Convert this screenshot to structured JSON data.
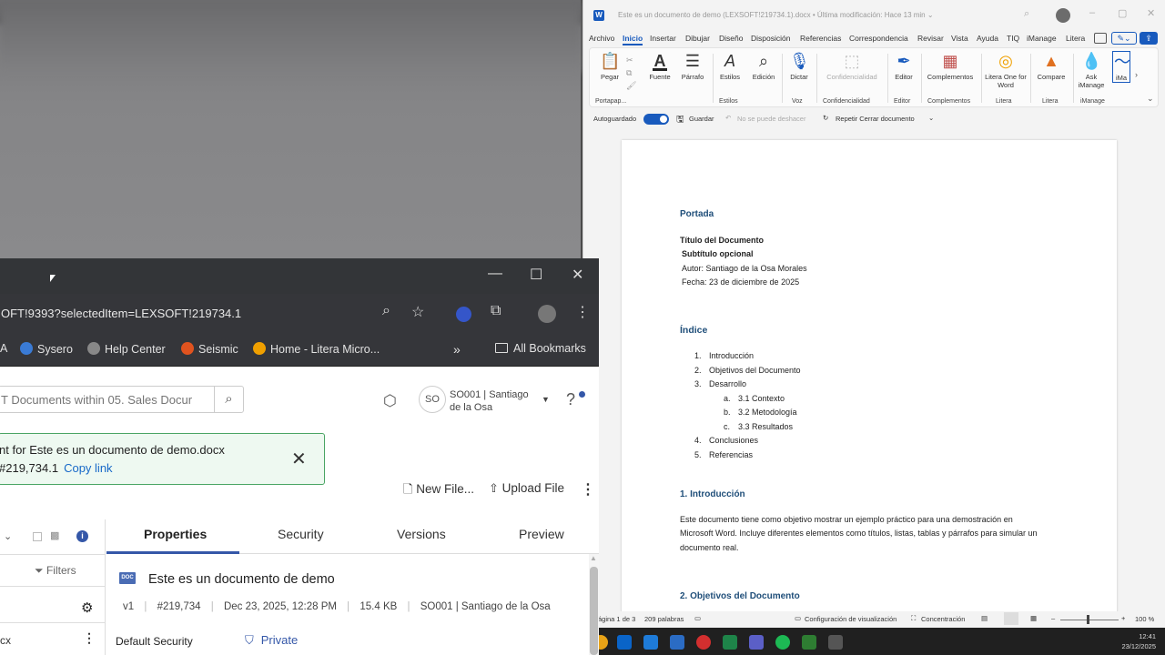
{
  "word": {
    "title": "Este es un documento de demo (LEXSOFT!219734.1).docx • Última modificación: Hace 13 min ⌄",
    "menu": [
      "Archivo",
      "Inicio",
      "Insertar",
      "Dibujar",
      "Diseño",
      "Disposición",
      "Referencias",
      "Correspondencia",
      "Revisar",
      "Vista",
      "Ayuda",
      "TIQ",
      "iManage",
      "Litera"
    ],
    "ribbon": {
      "pegar": "Pegar",
      "fuente": "Fuente",
      "parrafo": "Párrafo",
      "estilos": "Estilos",
      "edicion": "Edición",
      "dictar": "Dictar",
      "confidencialidad": "Confidencialidad",
      "editor": "Editor",
      "complementos": "Complementos",
      "litera_one": "Litera One for Word",
      "compare": "Compare",
      "ask_imanage": "Ask iManage",
      "ima": "iMa",
      "groups": {
        "portapapeles": "Portapap...",
        "estilos": "Estilos",
        "voz": "Voz",
        "confidencialidad": "Confidencialidad",
        "editor": "Editor",
        "complementos": "Complementos",
        "litera1": "Litera",
        "litera2": "Litera",
        "imanage": "iManage"
      }
    },
    "qat": {
      "autoguardado": "Autoguardado",
      "guardar": "Guardar",
      "deshacer": "No se puede deshacer",
      "repetir": "Repetir Cerrar documento"
    },
    "doc": {
      "portada": "Portada",
      "titulo": "Título del Documento",
      "subtitulo": "Subtítulo opcional",
      "autor": "Autor: Santiago de la Osa Morales",
      "fecha": "Fecha: 23 de diciembre de 2025",
      "indice": "Índice",
      "toc": [
        {
          "num": "1.",
          "text": "Introducción"
        },
        {
          "num": "2.",
          "text": "Objetivos del Documento"
        },
        {
          "num": "3.",
          "text": "Desarrollo"
        },
        {
          "num": "a.",
          "text": "3.1 Contexto"
        },
        {
          "num": "b.",
          "text": "3.2 Metodología"
        },
        {
          "num": "c.",
          "text": "3.3 Resultados"
        },
        {
          "num": "4.",
          "text": "Conclusiones"
        },
        {
          "num": "5.",
          "text": "Referencias"
        }
      ],
      "h1": "1. Introducción",
      "p1_l1": "Este documento tiene como objetivo mostrar un ejemplo práctico para una demostración en",
      "p1_l2": "Microsoft Word. Incluye diferentes elementos como títulos, listas, tablas y párrafos para simular un",
      "p1_l3": "documento real.",
      "h2": "2. Objetivos del Documento"
    },
    "status": {
      "pagina": "ágina 1 de 3",
      "palabras": "209 palabras",
      "config": "Configuración de visualización",
      "concentracion": "Concentración",
      "zoom": "100 %"
    }
  },
  "taskbar": {
    "time": "12:41",
    "date": "23/12/2025"
  },
  "browser": {
    "url": "OFT!9393?selectedItem=LEXSOFT!219734.1",
    "bookmarks": [
      "A",
      "Sysero",
      "Help Center",
      "Seismic",
      "Home - Litera Micro..."
    ],
    "all_bookmarks": "All Bookmarks",
    "app": {
      "search_placeholder": "T Documents within 05. Sales Docur",
      "user_initials": "SO",
      "user_name_l1": "SO001 | Santiago",
      "user_name_l2": "de la Osa",
      "toast_l1": "nt for Este es un documento de demo.docx",
      "toast_l2": "#219,734.1",
      "copy_link": "Copy link",
      "new_file": "New File...",
      "upload_file": "Upload File",
      "filters": "Filters",
      "left_item": "cx",
      "tabs": [
        "Properties",
        "Security",
        "Versions",
        "Preview"
      ],
      "doc_badge": "DOC",
      "doc_title": "Este es un documento de demo",
      "meta": {
        "version": "v1",
        "number": "#219,734",
        "date": "Dec 23, 2025, 12:28 PM",
        "size": "15.4 KB",
        "author": "SO001 | Santiago de la Osa"
      },
      "default_security": "Default Security",
      "private": "Private"
    }
  }
}
